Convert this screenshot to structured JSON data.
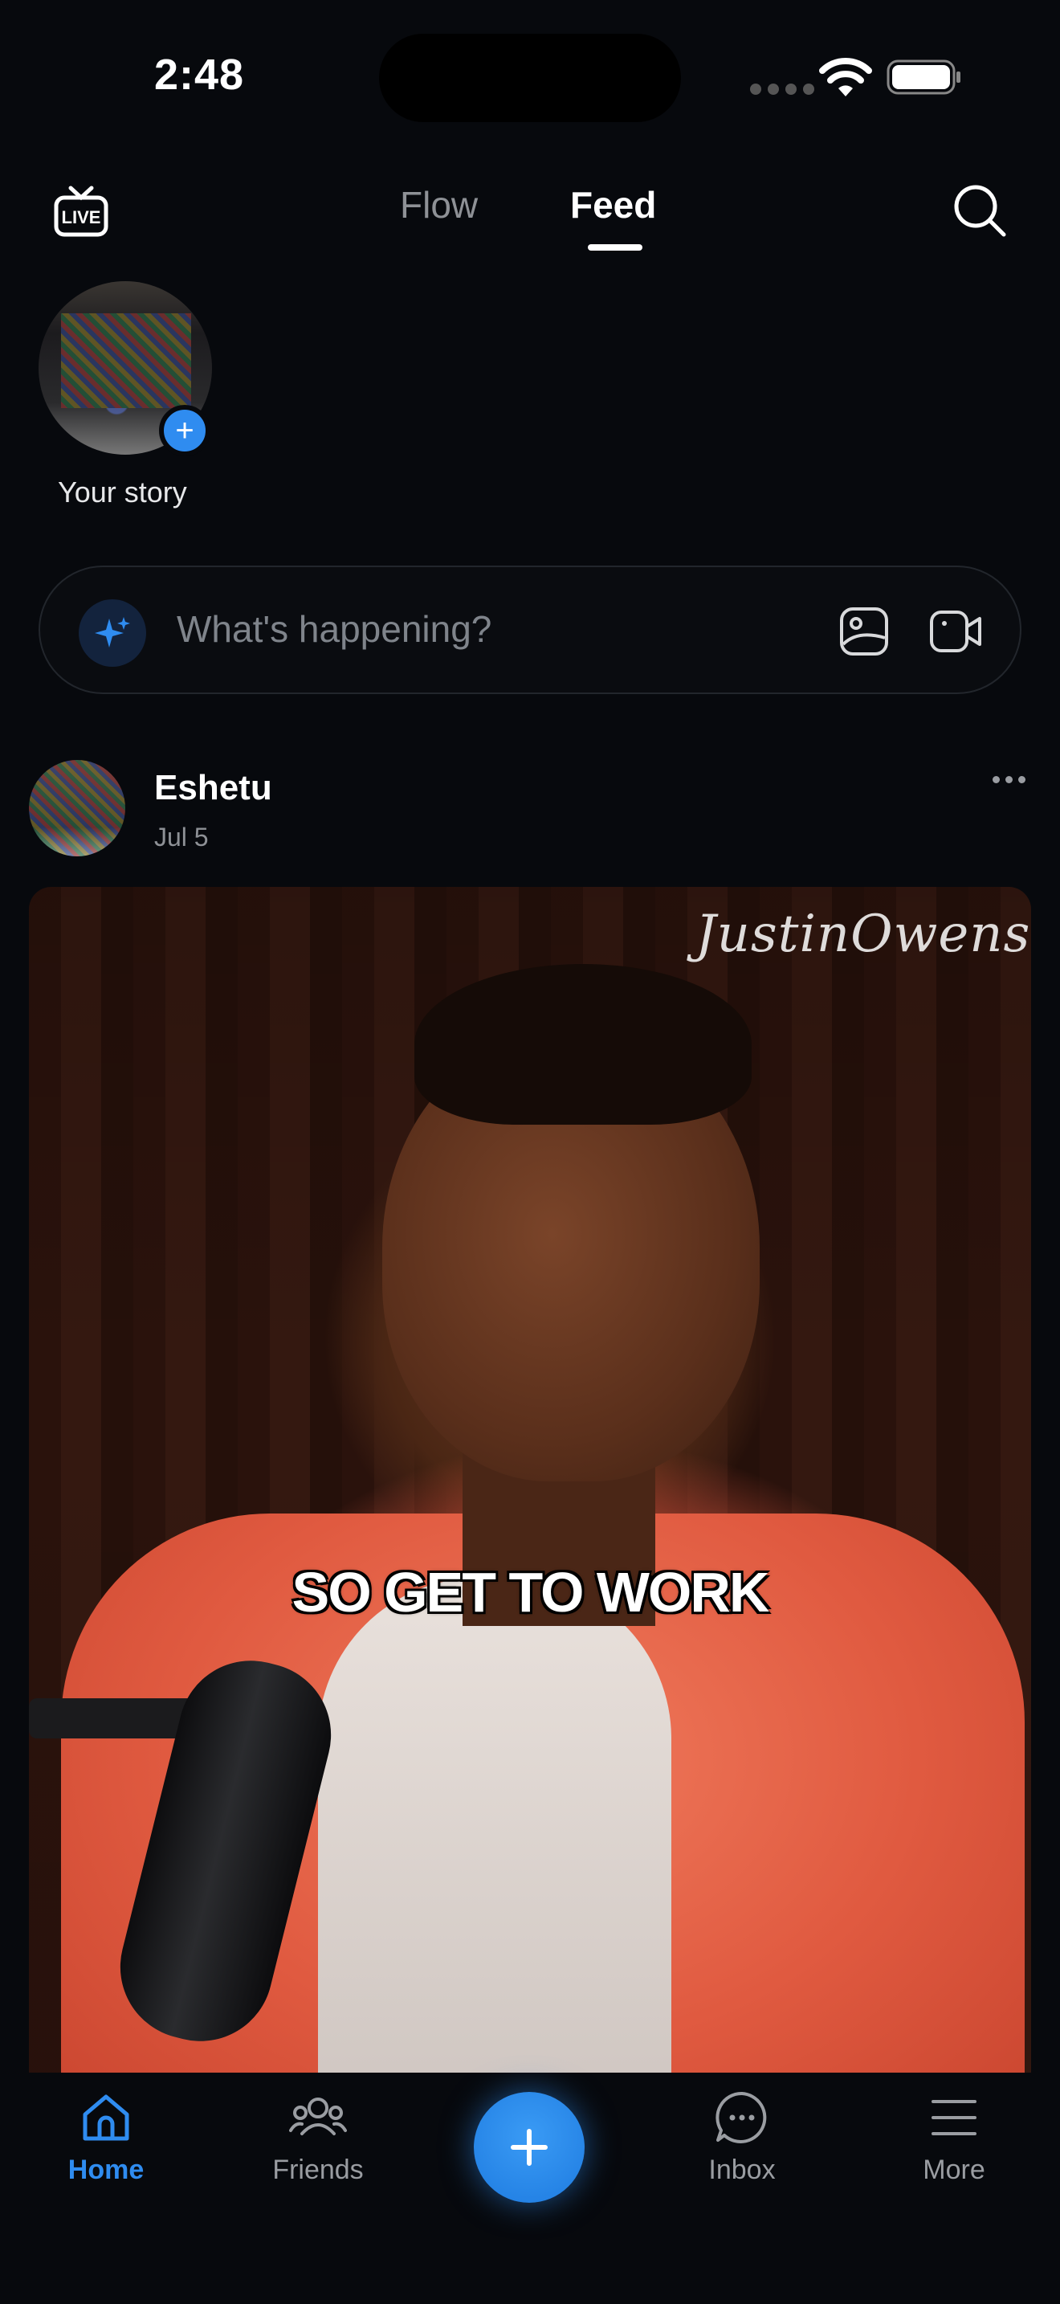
{
  "status_bar": {
    "time": "2:48"
  },
  "header": {
    "tabs": [
      {
        "label": "Flow",
        "active": false
      },
      {
        "label": "Feed",
        "active": true
      }
    ]
  },
  "story": {
    "label": "Your story"
  },
  "composer": {
    "placeholder": "What's happening?"
  },
  "post": {
    "author": "Eshetu",
    "date": "Jul 5",
    "media": {
      "watermark": "JustinOwens",
      "caption": "SO GET TO WORK"
    }
  },
  "bottom_nav": {
    "items": [
      {
        "label": "Home",
        "icon": "home-icon",
        "active": true
      },
      {
        "label": "Friends",
        "icon": "friends-icon",
        "active": false
      },
      {
        "label": "Inbox",
        "icon": "chat-bubble-icon",
        "active": false
      },
      {
        "label": "More",
        "icon": "menu-icon",
        "active": false
      }
    ],
    "create_icon": "plus-icon"
  },
  "colors": {
    "background": "#07090d",
    "accent": "#2f8cf0",
    "muted_text": "#8e9196"
  }
}
